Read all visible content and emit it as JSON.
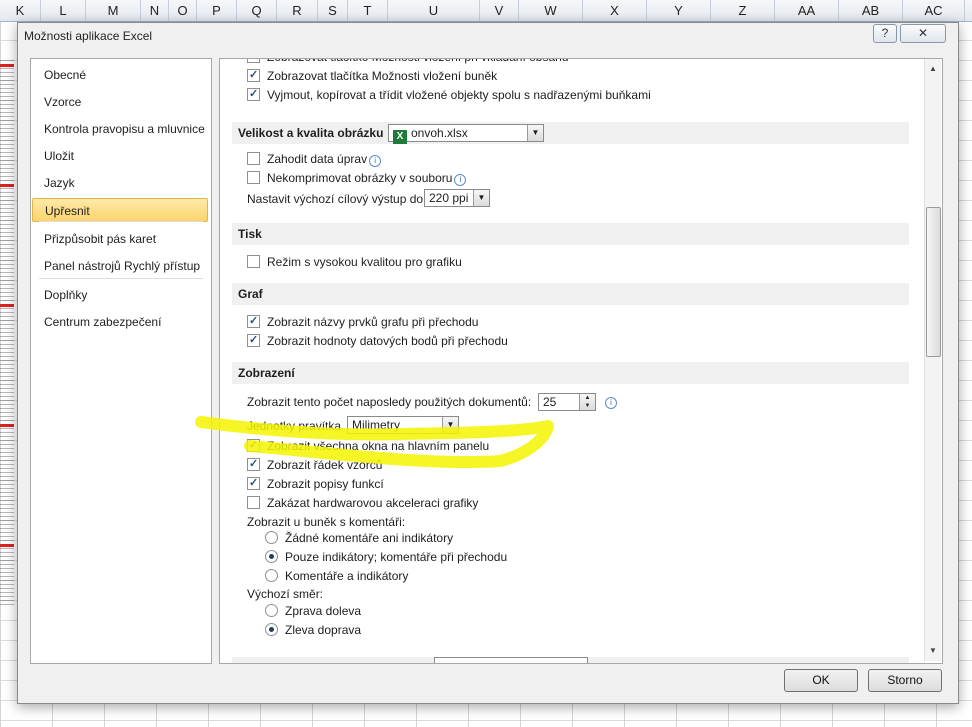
{
  "columns": [
    "K",
    "L",
    "M",
    "N",
    "O",
    "P",
    "Q",
    "R",
    "S",
    "T",
    "U",
    "V",
    "W",
    "X",
    "Y",
    "Z",
    "AA",
    "AB",
    "AC"
  ],
  "dialog": {
    "title": "Možnosti aplikace Excel",
    "help_label": "?",
    "close_label": "✕",
    "ok_label": "OK",
    "cancel_label": "Storno"
  },
  "nav": {
    "items": [
      "Obecné",
      "Vzorce",
      "Kontrola pravopisu a mluvnice",
      "Uložit",
      "Jazyk",
      "Upřesnit",
      "Přizpůsobit pás karet",
      "Panel nástrojů Rychlý přístup",
      "Doplňky",
      "Centrum zabezpečení"
    ],
    "selected": "Upřesnit"
  },
  "content": {
    "top_rows": [
      {
        "label": "Zobrazovat tlačítko Možnosti vložení při vkládání obsahu",
        "checked": true
      },
      {
        "label": "Zobrazovat tlačítka Možnosti vložení buněk",
        "checked": true
      },
      {
        "label": "Vyjmout, kopírovat a třídit vložené objekty spolu s nadřazenými buňkami",
        "checked": true
      }
    ],
    "image_section": {
      "header": "Velikost a kvalita obrázku",
      "file_value": "onvoh.xlsx",
      "rows": [
        {
          "label": "Zahodit data úprav",
          "checked": false
        },
        {
          "label": "Nekomprimovat obrázky v souboru",
          "checked": false
        }
      ],
      "ppi_label": "Nastavit výchozí cílový výstup do:",
      "ppi_value": "220 ppi"
    },
    "print_section": {
      "header": "Tisk",
      "rows": [
        {
          "label": "Režim s vysokou kvalitou pro grafiku",
          "checked": false
        }
      ]
    },
    "chart_section": {
      "header": "Graf",
      "rows": [
        {
          "label": "Zobrazit názvy prvků grafu při přechodu",
          "checked": true
        },
        {
          "label": "Zobrazit hodnoty datových bodů při přechodu",
          "checked": true
        }
      ]
    },
    "display_section": {
      "header": "Zobrazení",
      "recent_docs_label": "Zobrazit tento počet naposledy použitých  dokumentů:",
      "recent_docs_value": "25",
      "ruler_units_label": "Jednotky pravítka",
      "ruler_units_value": "Milimetry",
      "rows": [
        {
          "label": "Zobrazit všechna okna na hlavním panelu",
          "checked": true
        },
        {
          "label": "Zobrazit řádek vzorců",
          "checked": true
        },
        {
          "label": "Zobrazit popisy funkcí",
          "checked": true
        },
        {
          "label": "Zakázat hardwarovou akceleraci grafiky",
          "checked": false
        }
      ],
      "comments_label": "Zobrazit u buněk s komentáři:",
      "comments_options": [
        {
          "label": "Žádné komentáře ani indikátory",
          "checked": false
        },
        {
          "label": "Pouze indikátory; komentáře při přechodu",
          "checked": true
        },
        {
          "label": "Komentáře a indikátory",
          "checked": false
        }
      ],
      "direction_label": "Výchozí směr:",
      "direction_options": [
        {
          "label": "Zprava doleva",
          "checked": false
        },
        {
          "label": "Zleva doprava",
          "checked": true
        }
      ]
    }
  },
  "highlight_color": "#f4f400"
}
